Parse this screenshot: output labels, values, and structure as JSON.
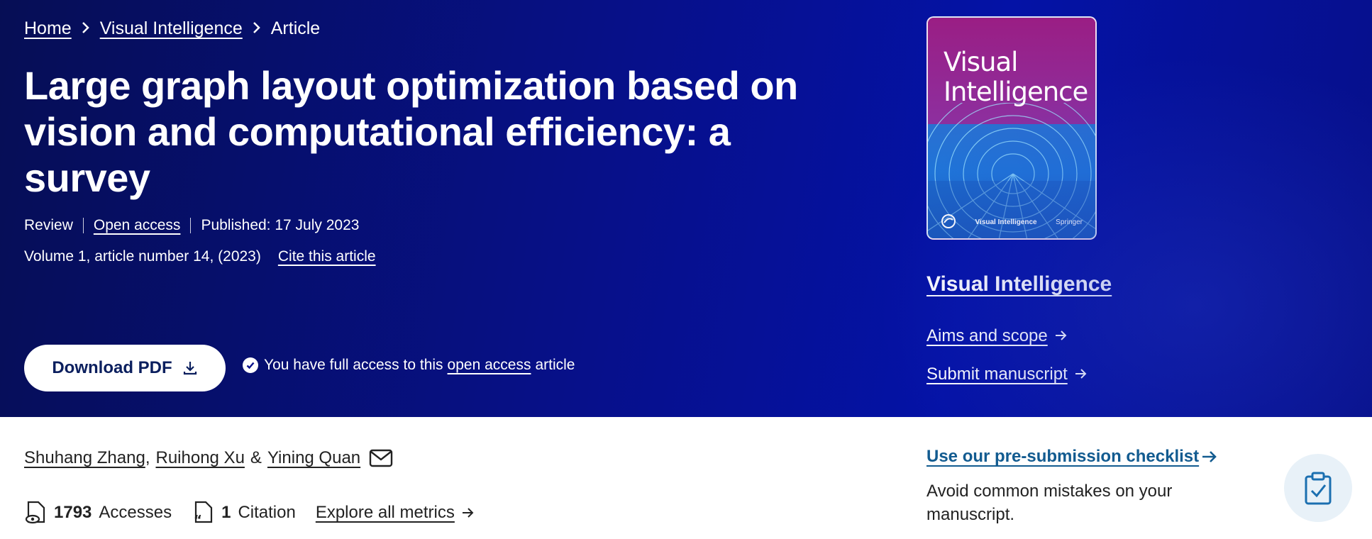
{
  "breadcrumb": {
    "home": "Home",
    "journal": "Visual Intelligence",
    "current": "Article"
  },
  "article": {
    "title": "Large graph layout optimization based on vision and computational efficiency: a survey",
    "type": "Review",
    "access": "Open access",
    "published": "Published: 17 July 2023",
    "volume": "Volume 1, article number 14, (2023)",
    "cite": "Cite this article"
  },
  "download": {
    "label": "Download PDF"
  },
  "access_note": {
    "prefix": "You have full access to this",
    "link": "open access",
    "suffix": "article"
  },
  "cover": {
    "title_line1": "Visual",
    "title_line2": "Intelligence",
    "footer_journal": "Visual Intelligence",
    "publisher": "Springer"
  },
  "journal_panel": {
    "name": "Visual Intelligence",
    "aims": "Aims and scope",
    "submit": "Submit manuscript"
  },
  "authors": [
    {
      "name": "Shuhang Zhang",
      "after": ","
    },
    {
      "name": "Ruihong Xu",
      "after": "&"
    },
    {
      "name": "Yining Quan",
      "after": ""
    }
  ],
  "metrics": {
    "accesses_count": "1793",
    "accesses_label": "Accesses",
    "citations_count": "1",
    "citations_label": "Citation",
    "explore": "Explore all metrics"
  },
  "checklist": {
    "link": "Use our pre-submission checklist",
    "description": "Avoid common mistakes on your manuscript."
  },
  "colors": {
    "hero_bg": "#07108a",
    "link_blue": "#125b90",
    "button_text": "#0b1f5e"
  }
}
